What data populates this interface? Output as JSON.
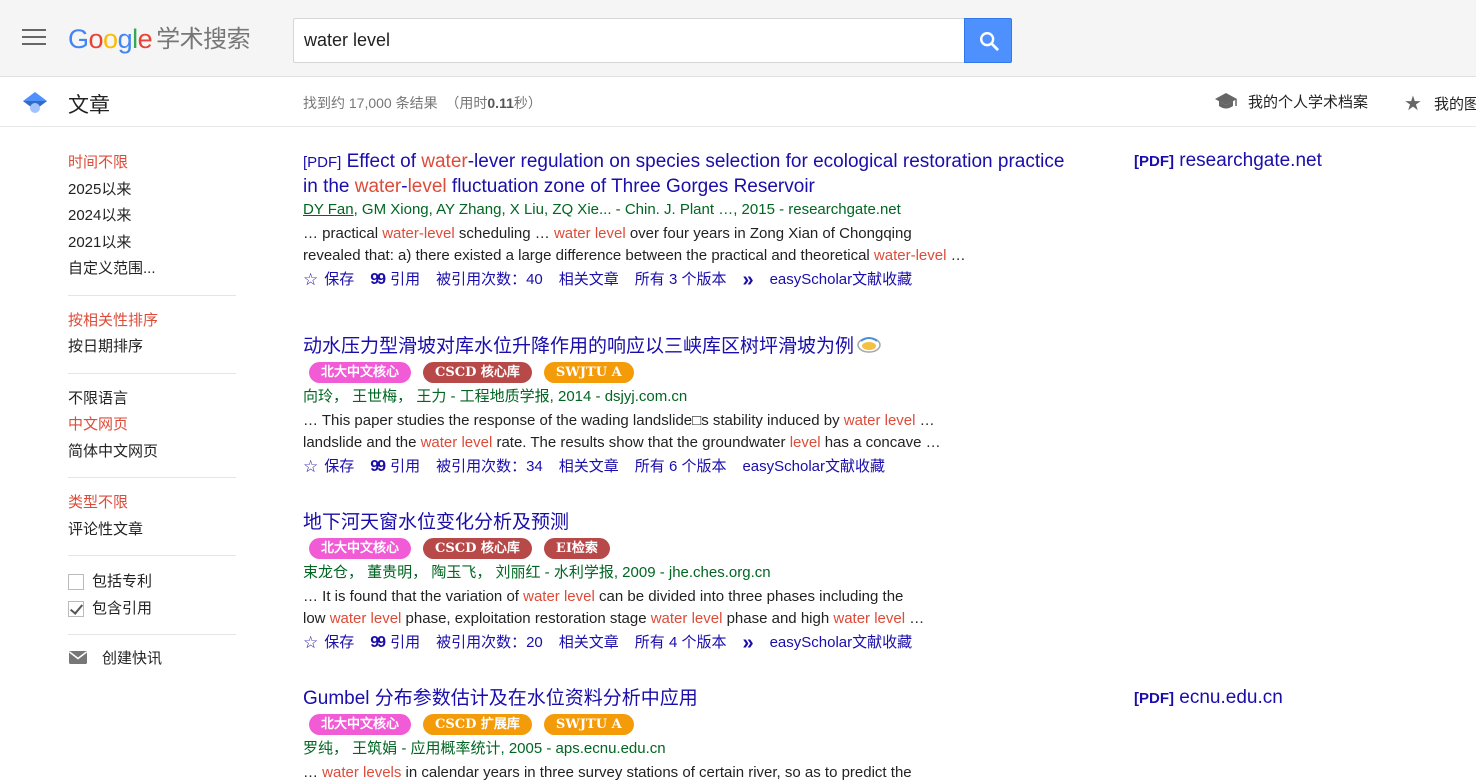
{
  "header": {
    "logo": {
      "google": [
        "G",
        "o",
        "o",
        "g",
        "l",
        "e"
      ],
      "product": "学术搜索"
    },
    "search": {
      "value": "water level",
      "placeholder": ""
    }
  },
  "subheader": {
    "section": "文章",
    "result_count_prefix": "找到约 17,000 条结果",
    "result_time_prefix": "（用时",
    "result_time": "0.11",
    "result_time_suffix": "秒）",
    "profile_label": "我的个人学术档案",
    "library_label": "我的图"
  },
  "sidebar": {
    "time": [
      "时间不限",
      "2025以来",
      "2024以来",
      "2021以来",
      "自定义范围..."
    ],
    "sort": [
      "按相关性排序",
      "按日期排序"
    ],
    "lang": [
      "不限语言",
      "中文网页",
      "简体中文网页"
    ],
    "type": [
      "类型不限",
      "评论性文章"
    ],
    "checks": [
      {
        "label": "包括专利",
        "checked": false
      },
      {
        "label": "包含引用",
        "checked": true
      }
    ],
    "alert": "创建快讯"
  },
  "colors": {
    "link": "#1a0dab",
    "highlight": "#dd4b39",
    "authors": "#006621",
    "badge_pink": "#f15bd5",
    "badge_red": "#b74949",
    "badge_orange": "#f49b0a"
  },
  "results": [
    {
      "title_tag": "[PDF]",
      "title_parts": [
        {
          "t": " Effect of ",
          "hl": false
        },
        {
          "t": "water",
          "hl": true
        },
        {
          "t": "-lever regulation on species selection for ecological restoration practice in the ",
          "hl": false
        },
        {
          "t": "water",
          "hl": true
        },
        {
          "t": "-",
          "hl": false
        },
        {
          "t": "level",
          "hl": true
        },
        {
          "t": " fluctuation zone of Three Gorges Reservoir",
          "hl": false
        }
      ],
      "badges": [],
      "authors_linked": "DY Fan",
      "authors_rest": ", GM Xiong, AY Zhang, X Liu, ZQ Xie... - Chin. J. Plant …, 2015 - researchgate.net",
      "snippet": [
        {
          "t": "… practical ",
          "hl": false
        },
        {
          "t": "water-level",
          "hl": true
        },
        {
          "t": " scheduling … ",
          "hl": false
        },
        {
          "t": "water level",
          "hl": true
        },
        {
          "t": " over four years in Zong Xian of Chongqing",
          "hl": false
        },
        {
          "t": "\nrevealed that: a) there existed a large difference between the practical and theoretical ",
          "hl": false
        },
        {
          "t": "water-level",
          "hl": true
        },
        {
          "t": " …",
          "hl": false
        }
      ],
      "actions": {
        "save": "保存",
        "cite": "引用",
        "cited": "被引用次数：40",
        "related": "相关文章",
        "versions": "所有 3 个版本",
        "easy": "easyScholar文献收藏"
      },
      "has_more": true,
      "right_pdf": {
        "tag": "[PDF]",
        "site": "researchgate.net"
      }
    },
    {
      "title_tag": "",
      "title_parts": [
        {
          "t": "动水压力型滑坡对库水位升降作用的响应以三峡库区树坪滑坡为例",
          "hl": false
        }
      ],
      "weibo": true,
      "badges": [
        {
          "label": "北大中文核心",
          "color": "#f15bd5"
        },
        {
          "label": "CSCD 核心库",
          "color": "#b74949"
        },
        {
          "label": "SWJTU A",
          "color": "#f49b0a"
        }
      ],
      "authors_linked": "",
      "authors_rest": "向玲， 王世梅， 王力 - 工程地质学报, 2014 - dsjyj.com.cn",
      "snippet": [
        {
          "t": "… This paper studies the response of the wading landslide□s stability induced by ",
          "hl": false
        },
        {
          "t": "water level",
          "hl": true
        },
        {
          "t": " …",
          "hl": false
        },
        {
          "t": "\nlandslide and the ",
          "hl": false
        },
        {
          "t": "water level",
          "hl": true
        },
        {
          "t": " rate. The results show that the groundwater ",
          "hl": false
        },
        {
          "t": "level",
          "hl": true
        },
        {
          "t": " has a concave …",
          "hl": false
        }
      ],
      "actions": {
        "save": "保存",
        "cite": "引用",
        "cited": "被引用次数：34",
        "related": "相关文章",
        "versions": "所有 6 个版本",
        "easy": "easyScholar文献收藏"
      },
      "has_more": false,
      "right_pdf": null
    },
    {
      "title_tag": "",
      "title_parts": [
        {
          "t": "地下河天窗水位变化分析及预测",
          "hl": false
        }
      ],
      "badges": [
        {
          "label": "北大中文核心",
          "color": "#f15bd5"
        },
        {
          "label": "CSCD 核心库",
          "color": "#b74949"
        },
        {
          "label": "EI检索",
          "color": "#b74949"
        }
      ],
      "authors_linked": "",
      "authors_rest": "束龙仓， 董贵明， 陶玉飞， 刘丽红 - 水利学报, 2009 - jhe.ches.org.cn",
      "snippet": [
        {
          "t": "… It is found that the variation of ",
          "hl": false
        },
        {
          "t": "water level",
          "hl": true
        },
        {
          "t": " can be divided into three phases including the",
          "hl": false
        },
        {
          "t": "\nlow ",
          "hl": false
        },
        {
          "t": "water level",
          "hl": true
        },
        {
          "t": " phase, exploitation restoration stage ",
          "hl": false
        },
        {
          "t": "water level",
          "hl": true
        },
        {
          "t": " phase and high ",
          "hl": false
        },
        {
          "t": "water level",
          "hl": true
        },
        {
          "t": " …",
          "hl": false
        }
      ],
      "actions": {
        "save": "保存",
        "cite": "引用",
        "cited": "被引用次数：20",
        "related": "相关文章",
        "versions": "所有 4 个版本",
        "easy": "easyScholar文献收藏"
      },
      "has_more": true,
      "right_pdf": null
    },
    {
      "title_tag": "",
      "title_parts": [
        {
          "t": "Gumbel 分布参数估计及在水位资料分析中应用",
          "hl": false
        }
      ],
      "badges": [
        {
          "label": "北大中文核心",
          "color": "#f15bd5"
        },
        {
          "label": "CSCD 扩展库",
          "color": "#f49b0a"
        },
        {
          "label": "SWJTU A",
          "color": "#f49b0a"
        }
      ],
      "authors_linked": "",
      "authors_rest": "罗纯， 王筑娟 - 应用概率统计, 2005 - aps.ecnu.edu.cn",
      "snippet": [
        {
          "t": "… ",
          "hl": false
        },
        {
          "t": "water levels",
          "hl": true
        },
        {
          "t": " in calendar years in three survey stations of certain river, so as to predict the",
          "hl": false
        }
      ],
      "actions": null,
      "has_more": false,
      "right_pdf": {
        "tag": "[PDF]",
        "site": "ecnu.edu.cn"
      }
    }
  ]
}
